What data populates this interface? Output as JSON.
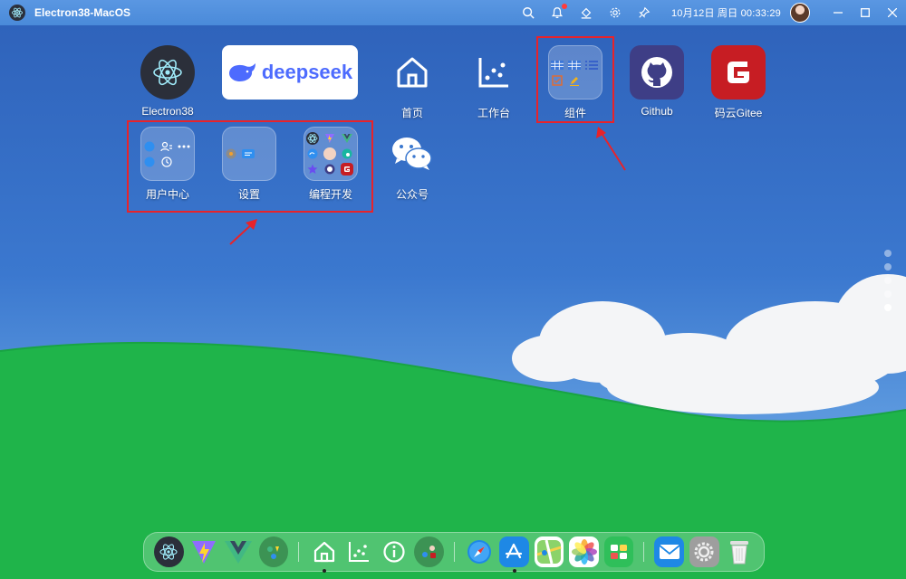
{
  "window": {
    "title": "Electron38-MacOS"
  },
  "topbar": {
    "datetime": "10月12日 周日 00:33:29"
  },
  "desktop": {
    "row1": [
      {
        "id": "electron",
        "label": "Electron38"
      },
      {
        "id": "deepseek",
        "label": "",
        "logo_text": "deepseek"
      },
      {
        "id": "home",
        "label": "首页"
      },
      {
        "id": "workbench",
        "label": "工作台"
      },
      {
        "id": "components",
        "label": "组件"
      },
      {
        "id": "github",
        "label": "Github"
      },
      {
        "id": "gitee",
        "label": "码云Gitee"
      }
    ],
    "row2": [
      {
        "id": "usercenter",
        "label": "用户中心"
      },
      {
        "id": "settings",
        "label": "设置"
      },
      {
        "id": "devtools",
        "label": "编程开发"
      },
      {
        "id": "wechat",
        "label": "公众号"
      }
    ]
  },
  "pager": {
    "count": 5,
    "active_index": 4
  },
  "dock": {
    "items": [
      "electron-icon",
      "vite-icon",
      "vue-icon",
      "folder-icon",
      "home-icon",
      "chart-icon",
      "info-icon",
      "apps-icon",
      "safari-icon",
      "appstore-icon",
      "maps-icon",
      "photos-icon",
      "calendar-icon",
      "mail-icon",
      "settings-icon",
      "trash-icon"
    ]
  },
  "colors": {
    "accent": "#e8232a",
    "github": "#3e3e86",
    "gitee": "#c71d23",
    "grass": "#1fb44a"
  }
}
